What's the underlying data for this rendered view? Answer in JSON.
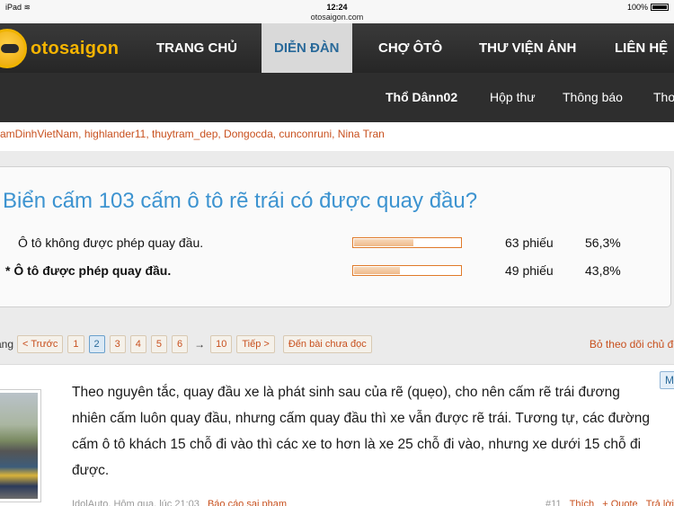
{
  "status_bar": {
    "device": "iPad",
    "wifi_icon": "wifi-icon",
    "time": "12:24",
    "url": "otosaigon.com",
    "battery": "100%",
    "battery_level": 1.0
  },
  "nav": {
    "logo": "otosaigon",
    "items": [
      "TRANG CHỦ",
      "DIỄN ĐÀN",
      "CHỢ ÔTÔ",
      "THƯ VIỆN ẢNH",
      "LIÊN HỆ"
    ],
    "active": "DIỄN ĐÀN",
    "active_bg": "#d9d9d9"
  },
  "subnav": {
    "username": "Thổ Dânn02",
    "inbox": "Hộp thư",
    "notifications": "Thông báo",
    "more": "Tho"
  },
  "online_users": "amDinhVietNam, highlander11, thuytram_dep, Dongocda, cunconruni, Nina Tran",
  "poll": {
    "title": "Biển cấm 103 cấm ô tô rẽ trái có được quay đầu?",
    "options": [
      {
        "marker": "",
        "label": "Ô tô không được phép quay đầu.",
        "votes": "63 phiếu",
        "percent": "56,3%",
        "fraction": 0.563
      },
      {
        "marker": "*",
        "label": "Ô tô được phép quay đầu.",
        "votes": "49 phiếu",
        "percent": "43,8%",
        "fraction": 0.438
      }
    ]
  },
  "pagination": {
    "label": "ang",
    "prev": "< Trước",
    "pages": [
      "1",
      "2",
      "3",
      "4",
      "5",
      "6"
    ],
    "current": "2",
    "arrow": "→",
    "last": "10",
    "next": "Tiếp >",
    "unread": "Đến bài chưa đọc",
    "unfollow": "Bỏ theo dõi chủ đề"
  },
  "post": {
    "badge": "M",
    "text": "Theo nguyên tắc, quay đầu xe là phát sinh sau của rẽ (quẹo), cho nên cấm rẽ trái đương nhiên cấm luôn quay đầu, nhưng cấm quay đầu thì xe vẫn được rẽ trái. Tương tự, các đường cấm ô tô khách 15 chỗ đi vào thì các xe to hơn là xe 25 chỗ đi vào, nhưng xe dưới 15 chỗ đi được.",
    "footer_meta": "IdolAuto, Hôm qua, lúc 21:03",
    "report": "Báo cáo sai phạm",
    "number": "#11",
    "like": "Thích",
    "quote": "+ Quote",
    "reply": "Trả lời"
  },
  "colors": {
    "accent_orange": "#c8501e",
    "link_blue": "#3c93d0",
    "nav_bg": "#2e2e2e",
    "logo_yellow": "#f5b400"
  }
}
